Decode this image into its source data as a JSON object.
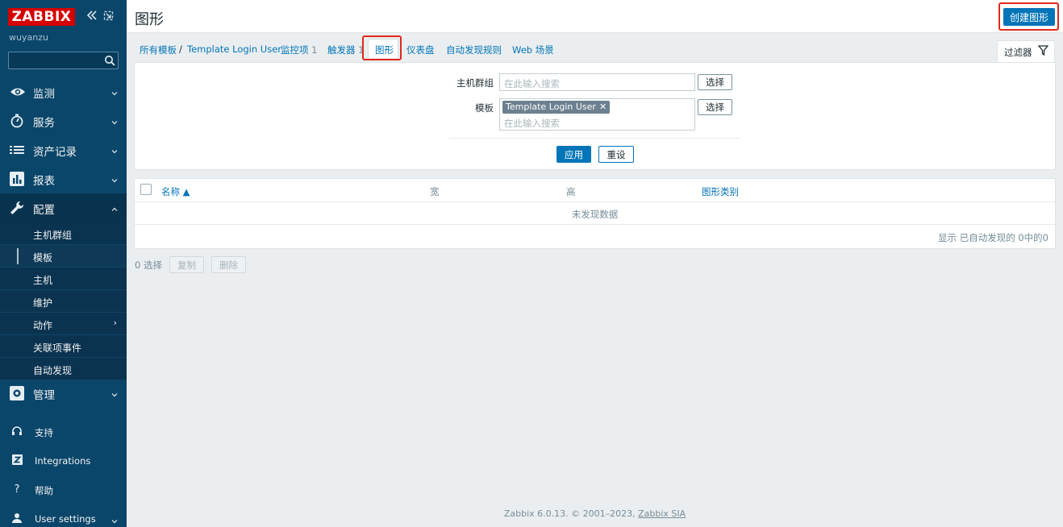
{
  "app": {
    "logo_text": "ZABBIX",
    "username": "wuyanzu"
  },
  "sidebar": {
    "menu": [
      {
        "label": "监测",
        "icon": "eye-icon"
      },
      {
        "label": "服务",
        "icon": "stopwatch-icon"
      },
      {
        "label": "资产记录",
        "icon": "list-icon"
      },
      {
        "label": "报表",
        "icon": "bar-chart-icon"
      },
      {
        "label": "配置",
        "icon": "wrench-icon"
      },
      {
        "label": "管理",
        "icon": "gear-icon"
      }
    ],
    "config_submenu": [
      "主机群组",
      "模板",
      "主机",
      "维护",
      "动作",
      "关联项事件",
      "自动发现"
    ],
    "footer": [
      {
        "label": "支持",
        "icon": "headset-icon"
      },
      {
        "label": "Integrations",
        "icon": "zabbix-z-icon"
      },
      {
        "label": "帮助",
        "icon": "help-icon"
      },
      {
        "label": "User settings",
        "icon": "user-icon"
      }
    ]
  },
  "header": {
    "title": "图形",
    "create_button": "创建图形"
  },
  "breadcrumb": {
    "all_templates": "所有模板",
    "separator": "/",
    "template": "Template Login User",
    "items_label": "监控项",
    "items_count": "1",
    "triggers_label": "触发器",
    "triggers_count": "1",
    "graphs": "图形",
    "dashboards": "仪表盘",
    "discovery": "自动发现规则",
    "web": "Web 场景"
  },
  "filter": {
    "tab_label": "过滤器",
    "host_group_label": "主机群组",
    "host_group_placeholder": "在此输入搜索",
    "template_label": "模板",
    "template_chip": "Template Login User",
    "template_placeholder": "在此输入搜索",
    "select_button": "选择",
    "apply_button": "应用",
    "reset_button": "重设"
  },
  "table": {
    "columns": [
      "名称 ▲",
      "宽",
      "高",
      "图形类别"
    ],
    "empty_text": "未发现数据",
    "paging_text": "显示 已自动发现的 0中的0"
  },
  "actions": {
    "selected_count": "0 选择",
    "copy_button": "复制",
    "delete_button": "删除"
  },
  "footer": {
    "text": "Zabbix 6.0.13. © 2001–2023, ",
    "link": "Zabbix SIA"
  },
  "colors": {
    "sidebar": "#0a466a",
    "accent": "#0275b8",
    "logo": "#d40000",
    "highlight": "#e0291a"
  }
}
